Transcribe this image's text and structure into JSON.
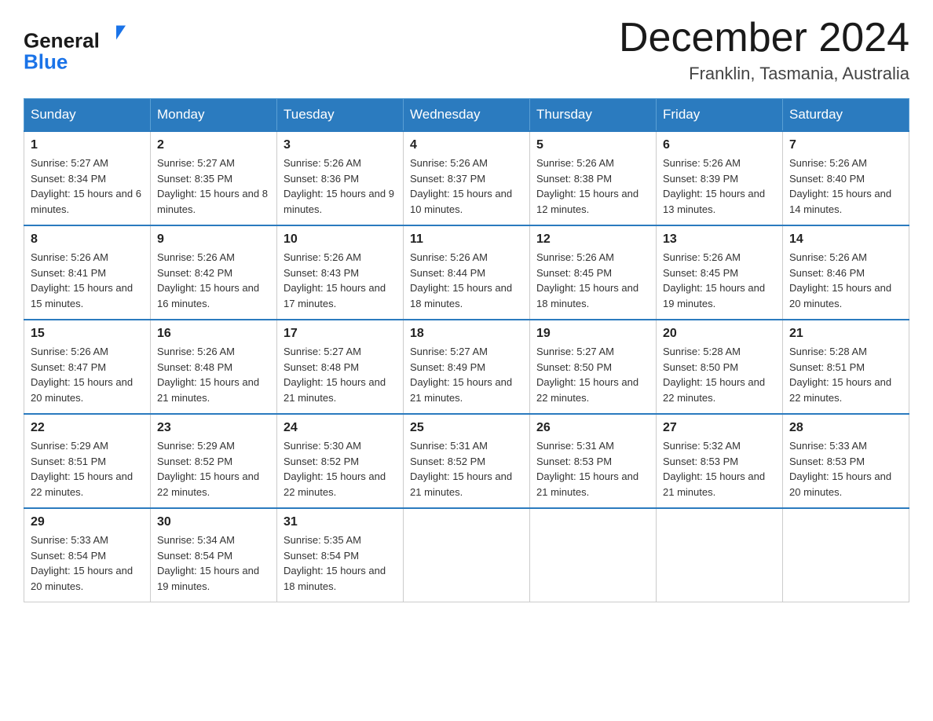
{
  "header": {
    "logo_general": "General",
    "logo_blue": "Blue",
    "month_title": "December 2024",
    "location": "Franklin, Tasmania, Australia"
  },
  "days_of_week": [
    "Sunday",
    "Monday",
    "Tuesday",
    "Wednesday",
    "Thursday",
    "Friday",
    "Saturday"
  ],
  "weeks": [
    [
      {
        "day": "1",
        "sunrise": "Sunrise: 5:27 AM",
        "sunset": "Sunset: 8:34 PM",
        "daylight": "Daylight: 15 hours and 6 minutes."
      },
      {
        "day": "2",
        "sunrise": "Sunrise: 5:27 AM",
        "sunset": "Sunset: 8:35 PM",
        "daylight": "Daylight: 15 hours and 8 minutes."
      },
      {
        "day": "3",
        "sunrise": "Sunrise: 5:26 AM",
        "sunset": "Sunset: 8:36 PM",
        "daylight": "Daylight: 15 hours and 9 minutes."
      },
      {
        "day": "4",
        "sunrise": "Sunrise: 5:26 AM",
        "sunset": "Sunset: 8:37 PM",
        "daylight": "Daylight: 15 hours and 10 minutes."
      },
      {
        "day": "5",
        "sunrise": "Sunrise: 5:26 AM",
        "sunset": "Sunset: 8:38 PM",
        "daylight": "Daylight: 15 hours and 12 minutes."
      },
      {
        "day": "6",
        "sunrise": "Sunrise: 5:26 AM",
        "sunset": "Sunset: 8:39 PM",
        "daylight": "Daylight: 15 hours and 13 minutes."
      },
      {
        "day": "7",
        "sunrise": "Sunrise: 5:26 AM",
        "sunset": "Sunset: 8:40 PM",
        "daylight": "Daylight: 15 hours and 14 minutes."
      }
    ],
    [
      {
        "day": "8",
        "sunrise": "Sunrise: 5:26 AM",
        "sunset": "Sunset: 8:41 PM",
        "daylight": "Daylight: 15 hours and 15 minutes."
      },
      {
        "day": "9",
        "sunrise": "Sunrise: 5:26 AM",
        "sunset": "Sunset: 8:42 PM",
        "daylight": "Daylight: 15 hours and 16 minutes."
      },
      {
        "day": "10",
        "sunrise": "Sunrise: 5:26 AM",
        "sunset": "Sunset: 8:43 PM",
        "daylight": "Daylight: 15 hours and 17 minutes."
      },
      {
        "day": "11",
        "sunrise": "Sunrise: 5:26 AM",
        "sunset": "Sunset: 8:44 PM",
        "daylight": "Daylight: 15 hours and 18 minutes."
      },
      {
        "day": "12",
        "sunrise": "Sunrise: 5:26 AM",
        "sunset": "Sunset: 8:45 PM",
        "daylight": "Daylight: 15 hours and 18 minutes."
      },
      {
        "day": "13",
        "sunrise": "Sunrise: 5:26 AM",
        "sunset": "Sunset: 8:45 PM",
        "daylight": "Daylight: 15 hours and 19 minutes."
      },
      {
        "day": "14",
        "sunrise": "Sunrise: 5:26 AM",
        "sunset": "Sunset: 8:46 PM",
        "daylight": "Daylight: 15 hours and 20 minutes."
      }
    ],
    [
      {
        "day": "15",
        "sunrise": "Sunrise: 5:26 AM",
        "sunset": "Sunset: 8:47 PM",
        "daylight": "Daylight: 15 hours and 20 minutes."
      },
      {
        "day": "16",
        "sunrise": "Sunrise: 5:26 AM",
        "sunset": "Sunset: 8:48 PM",
        "daylight": "Daylight: 15 hours and 21 minutes."
      },
      {
        "day": "17",
        "sunrise": "Sunrise: 5:27 AM",
        "sunset": "Sunset: 8:48 PM",
        "daylight": "Daylight: 15 hours and 21 minutes."
      },
      {
        "day": "18",
        "sunrise": "Sunrise: 5:27 AM",
        "sunset": "Sunset: 8:49 PM",
        "daylight": "Daylight: 15 hours and 21 minutes."
      },
      {
        "day": "19",
        "sunrise": "Sunrise: 5:27 AM",
        "sunset": "Sunset: 8:50 PM",
        "daylight": "Daylight: 15 hours and 22 minutes."
      },
      {
        "day": "20",
        "sunrise": "Sunrise: 5:28 AM",
        "sunset": "Sunset: 8:50 PM",
        "daylight": "Daylight: 15 hours and 22 minutes."
      },
      {
        "day": "21",
        "sunrise": "Sunrise: 5:28 AM",
        "sunset": "Sunset: 8:51 PM",
        "daylight": "Daylight: 15 hours and 22 minutes."
      }
    ],
    [
      {
        "day": "22",
        "sunrise": "Sunrise: 5:29 AM",
        "sunset": "Sunset: 8:51 PM",
        "daylight": "Daylight: 15 hours and 22 minutes."
      },
      {
        "day": "23",
        "sunrise": "Sunrise: 5:29 AM",
        "sunset": "Sunset: 8:52 PM",
        "daylight": "Daylight: 15 hours and 22 minutes."
      },
      {
        "day": "24",
        "sunrise": "Sunrise: 5:30 AM",
        "sunset": "Sunset: 8:52 PM",
        "daylight": "Daylight: 15 hours and 22 minutes."
      },
      {
        "day": "25",
        "sunrise": "Sunrise: 5:31 AM",
        "sunset": "Sunset: 8:52 PM",
        "daylight": "Daylight: 15 hours and 21 minutes."
      },
      {
        "day": "26",
        "sunrise": "Sunrise: 5:31 AM",
        "sunset": "Sunset: 8:53 PM",
        "daylight": "Daylight: 15 hours and 21 minutes."
      },
      {
        "day": "27",
        "sunrise": "Sunrise: 5:32 AM",
        "sunset": "Sunset: 8:53 PM",
        "daylight": "Daylight: 15 hours and 21 minutes."
      },
      {
        "day": "28",
        "sunrise": "Sunrise: 5:33 AM",
        "sunset": "Sunset: 8:53 PM",
        "daylight": "Daylight: 15 hours and 20 minutes."
      }
    ],
    [
      {
        "day": "29",
        "sunrise": "Sunrise: 5:33 AM",
        "sunset": "Sunset: 8:54 PM",
        "daylight": "Daylight: 15 hours and 20 minutes."
      },
      {
        "day": "30",
        "sunrise": "Sunrise: 5:34 AM",
        "sunset": "Sunset: 8:54 PM",
        "daylight": "Daylight: 15 hours and 19 minutes."
      },
      {
        "day": "31",
        "sunrise": "Sunrise: 5:35 AM",
        "sunset": "Sunset: 8:54 PM",
        "daylight": "Daylight: 15 hours and 18 minutes."
      },
      null,
      null,
      null,
      null
    ]
  ]
}
